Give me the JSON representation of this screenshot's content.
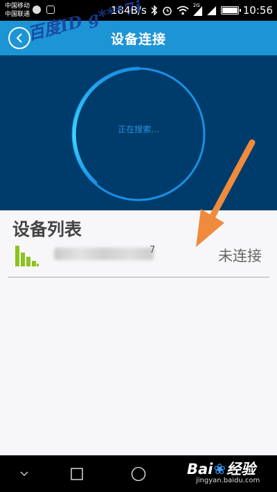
{
  "status_bar": {
    "carrier_1": "中国移动",
    "carrier_2": "中国联通",
    "net_speed": "184B/s",
    "network_type": "2G",
    "time": "10:56",
    "icons": [
      "sync-icon",
      "image-icon",
      "bluetooth-icon",
      "alarm-icon",
      "wifi-icon",
      "signal-icon",
      "signal-icon",
      "battery-icon"
    ]
  },
  "header": {
    "title": "设备连接",
    "watermark": "百度ID g***7i"
  },
  "scan": {
    "status_text": "正在搜索...",
    "colors": {
      "background": "#003c6b",
      "ring": "#1a8fe6",
      "ring_glow": "#3ad8ff"
    }
  },
  "device_list": {
    "title": "设备列表",
    "devices": [
      {
        "name_suffix": "7",
        "status": "未连接",
        "signal": "signal-bars-icon"
      }
    ]
  },
  "annotation": {
    "arrow_color": "#f08a3c"
  },
  "nav": {
    "buttons": [
      "back-icon",
      "recent-apps-icon",
      "home-icon"
    ]
  },
  "branding": {
    "logo_left": "Bai",
    "logo_right": "经验",
    "subtitle": "jingyan.baidu.com"
  },
  "colors": {
    "header": "#1d95d4",
    "signal_green": "#8dc21f",
    "list_bg": "#f7f7f9"
  }
}
